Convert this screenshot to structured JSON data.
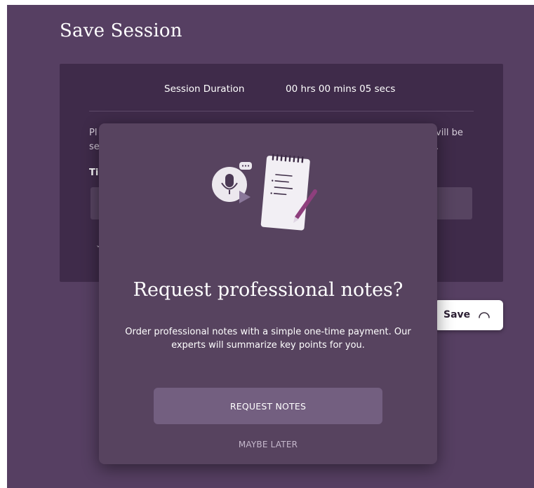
{
  "page": {
    "title": "Save Session"
  },
  "session_card": {
    "duration_label": "Session Duration",
    "duration_value": "00 hrs 00 mins 05 secs",
    "partial_text_left_line1": "Pl",
    "partial_text_left_line2": "se",
    "partial_text_right_line1": "vill be",
    "partial_text_right_line2": ".",
    "partial_label": "Ti"
  },
  "save_button": {
    "label": "Save"
  },
  "modal": {
    "title": "Request professional notes?",
    "body": "Order professional notes with a simple one-time payment. Our experts will summarize key points for you.",
    "primary_button": "REQUEST NOTES",
    "secondary_link": "MAYBE LATER"
  },
  "icons": {
    "illustration": "notepad-and-microphone-illustration",
    "spinner": "loading-spinner-icon"
  },
  "colors": {
    "background": "#563f62",
    "card": "#3f2b4a",
    "modal": "#57435f",
    "primary_button": "#735f80",
    "accent_pencil": "#8e3f7d"
  }
}
